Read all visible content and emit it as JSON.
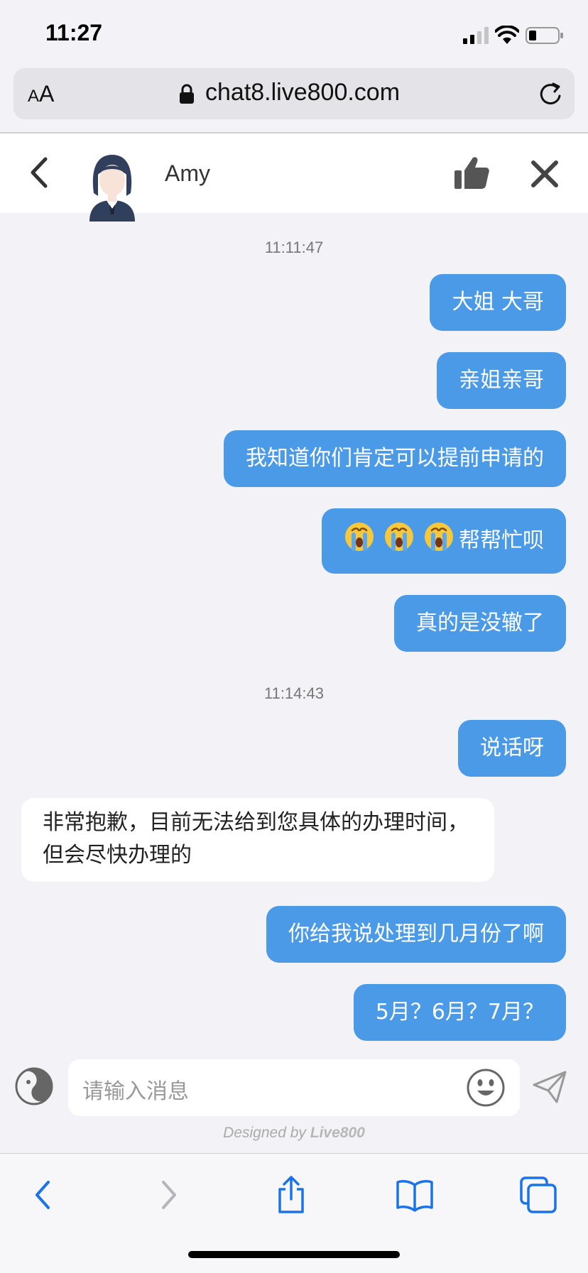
{
  "status_bar": {
    "time": "11:27"
  },
  "browser": {
    "aa_small": "A",
    "aa_large": "A",
    "url": "chat8.live800.com"
  },
  "header": {
    "agent_name": "Amy"
  },
  "messages": {
    "timestamp_1": "11:11:47",
    "msg_1": "大姐 大哥",
    "msg_2": "亲姐亲哥",
    "msg_3": "我知道你们肯定可以提前申请的",
    "msg_4": "帮帮忙呗",
    "msg_4_emoji": "crying-face",
    "msg_5": "真的是没辙了",
    "timestamp_2": "11:14:43",
    "msg_6": "说话呀",
    "agent_reply": "非常抱歉，目前无法给到您具体的办理时间，但会尽快办理的",
    "msg_7": "你给我说处理到几月份了啊",
    "msg_8": "5月？6月？7月？"
  },
  "input": {
    "placeholder": "请输入消息",
    "designed_by_prefix": "Designed by ",
    "designed_by_brand": "Live800"
  },
  "colors": {
    "user_bubble": "#4a9ae8",
    "agent_bubble": "#ffffff",
    "background": "#f2f2f7",
    "toolbar_icons": "#1a73e8"
  }
}
